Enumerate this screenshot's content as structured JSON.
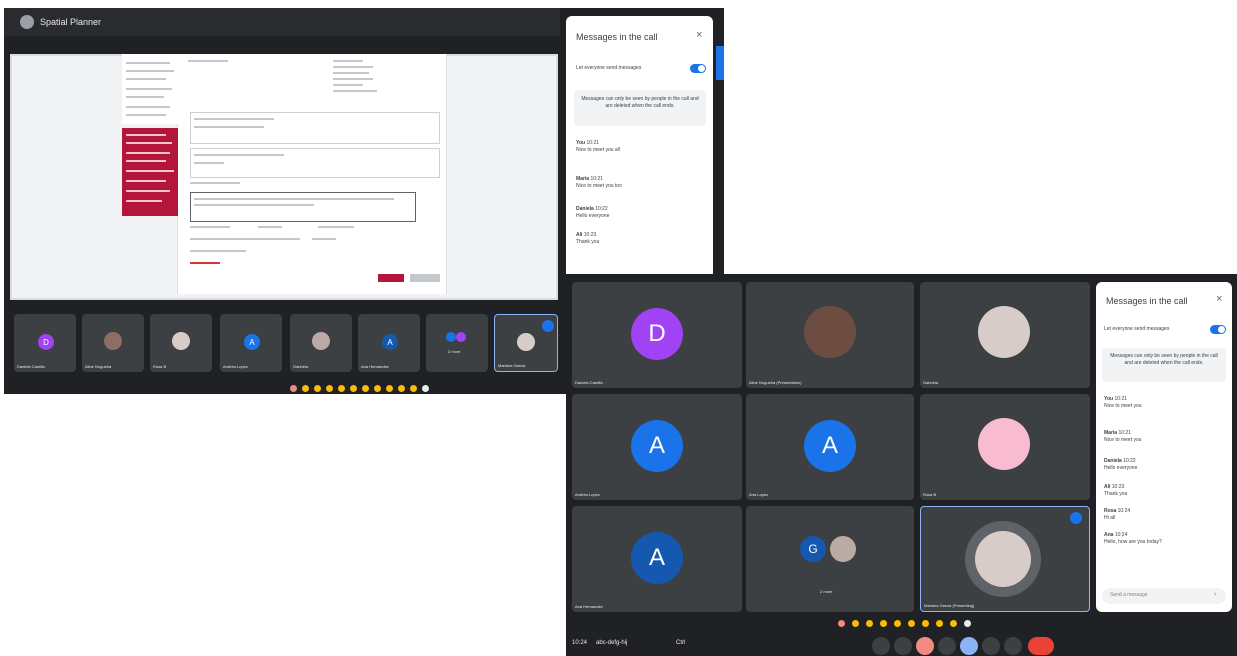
{
  "screen1": {
    "window_title": "Spatial Planner",
    "panel": {
      "title": "Messages in the call",
      "close": "×",
      "toggle_label": "Let everyone send messages",
      "info": "Messages can only be seen by people in the call and are deleted when the call ends.",
      "messages": [
        {
          "sender": "You",
          "time": "10:21",
          "text": "Nice to meet you all"
        },
        {
          "sender": "Maria",
          "time": "10:21",
          "text": "Nice to meet you too"
        },
        {
          "sender": "Daniela",
          "time": "10:22",
          "text": "Hello everyone"
        },
        {
          "sender": "Ali",
          "time": "10:23",
          "text": "Thank you"
        }
      ]
    },
    "tiles": [
      {
        "name": "Daniela Castillo",
        "initial": "D",
        "color": "#a142f4"
      },
      {
        "name": "Aline Nogueira",
        "initial": "",
        "color": ""
      },
      {
        "name": "Rosa B",
        "initial": "",
        "color": ""
      },
      {
        "name": "Andrea Lopez",
        "initial": "A",
        "color": "#1a73e8"
      },
      {
        "name": "Gabriela",
        "initial": "",
        "color": ""
      },
      {
        "name": "Ana Hernandez",
        "initial": "A",
        "color": "#1558b0"
      },
      {
        "name": "2 more",
        "initial": "",
        "color": ""
      },
      {
        "name": "Mariana Garcia",
        "initial": "",
        "color": ""
      }
    ]
  },
  "screen2": {
    "panel": {
      "title": "Messages in the call",
      "close": "×",
      "toggle_label": "Let everyone send messages",
      "info": "Messages can only be seen by people in the call and are deleted when the call ends.",
      "messages": [
        {
          "sender": "You",
          "time": "10:21",
          "text": "Nice to meet you"
        },
        {
          "sender": "Maria",
          "time": "10:21",
          "text": "Nice to meet you"
        },
        {
          "sender": "Daniela",
          "time": "10:22",
          "text": "Hello everyone"
        },
        {
          "sender": "Ali",
          "time": "10:23",
          "text": "Thank you"
        },
        {
          "sender": "Rosa",
          "time": "10:24",
          "text": "Hi all"
        },
        {
          "sender": "Ana",
          "time": "10:24",
          "text": "Hello, how are you today?"
        }
      ],
      "input_placeholder": "Send a message"
    },
    "tiles": [
      {
        "name": "Daniela Castillo",
        "initial": "D",
        "color": "#a142f4"
      },
      {
        "name": "Aline Nogueira (Presentation)",
        "initial": "",
        "color": ""
      },
      {
        "name": "Gabriela",
        "initial": "",
        "color": ""
      },
      {
        "name": "Andrea Lopez",
        "initial": "A",
        "color": "#1a73e8"
      },
      {
        "name": "Ana Lopez",
        "initial": "A",
        "color": "#1a73e8"
      },
      {
        "name": "Rosa B",
        "initial": "",
        "color": ""
      },
      {
        "name": "Ana Hernandez",
        "initial": "A",
        "color": "#1558b0"
      },
      {
        "name": "2 more",
        "initial": "G",
        "color": "#1558b0"
      },
      {
        "name": "Mariana Garcia (Presenting)",
        "initial": "",
        "color": ""
      }
    ],
    "bottom_bar": {
      "time": "10:24",
      "meeting_code": "abc-defg-hij",
      "hint": "Ctrl"
    }
  }
}
